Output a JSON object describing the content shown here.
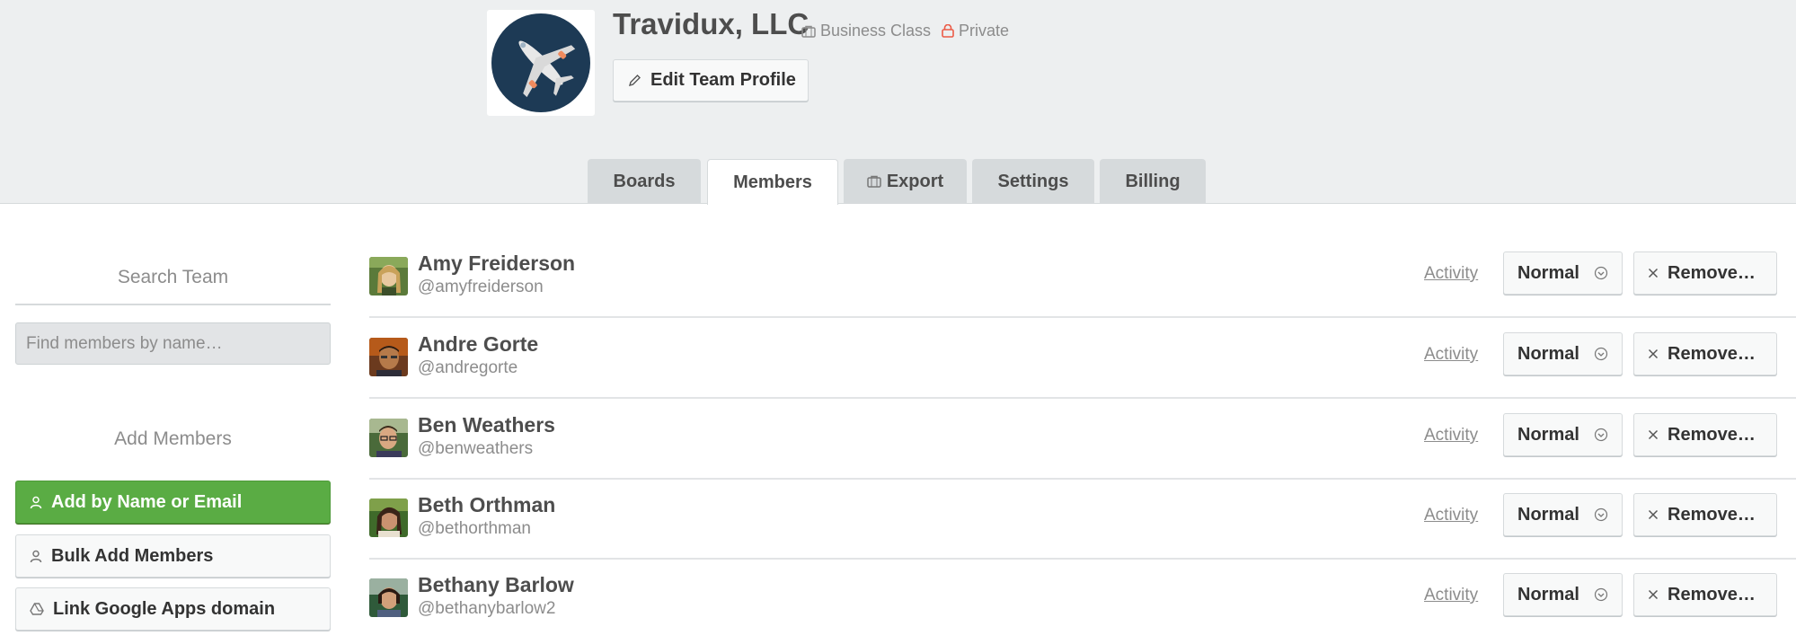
{
  "team": {
    "name": "Travidux, LLC",
    "badge_business": "Business Class",
    "badge_private": "Private",
    "edit_label": "Edit Team Profile"
  },
  "tabs": [
    {
      "label": "Boards",
      "active": false
    },
    {
      "label": "Members",
      "active": true
    },
    {
      "label": "Export",
      "active": false,
      "icon": "briefcase-icon"
    },
    {
      "label": "Settings",
      "active": false
    },
    {
      "label": "Billing",
      "active": false
    }
  ],
  "sidebar": {
    "search_heading": "Search Team",
    "search_placeholder": "Find members by name…",
    "add_heading": "Add Members",
    "add_by_name_label": "Add by Name or Email",
    "bulk_add_label": "Bulk Add Members",
    "link_google_label": "Link Google Apps domain"
  },
  "members": [
    {
      "name": "Amy Freiderson",
      "username": "@amyfreiderson",
      "activity": "Activity",
      "permission": "Normal",
      "remove": "Remove…"
    },
    {
      "name": "Andre Gorte",
      "username": "@andregorte",
      "activity": "Activity",
      "permission": "Normal",
      "remove": "Remove…"
    },
    {
      "name": "Ben Weathers",
      "username": "@benweathers",
      "activity": "Activity",
      "permission": "Normal",
      "remove": "Remove…"
    },
    {
      "name": "Beth Orthman",
      "username": "@bethorthman",
      "activity": "Activity",
      "permission": "Normal",
      "remove": "Remove…"
    },
    {
      "name": "Bethany Barlow",
      "username": "@bethanybarlow2",
      "activity": "Activity",
      "permission": "Normal",
      "remove": "Remove…"
    }
  ],
  "colors": {
    "header_bg": "#edeff0",
    "tab_bg": "#d6dadc",
    "primary_green": "#5aac44",
    "private_red": "#eb5a46",
    "logo_navy": "#1d3a55"
  }
}
